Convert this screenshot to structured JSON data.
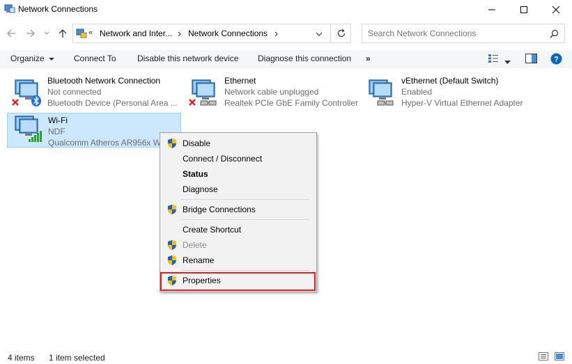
{
  "window": {
    "title": "Network Connections"
  },
  "address": {
    "overflow": "«",
    "crumbs": [
      "Network and Inter...",
      "Network Connections"
    ],
    "search_placeholder": "Search Network Connections"
  },
  "toolbar": {
    "organize": "Organize",
    "connect_to": "Connect To",
    "disable": "Disable this network device",
    "diagnose": "Diagnose this connection",
    "more": "»"
  },
  "connections": [
    {
      "name": "Bluetooth Network Connection",
      "status": "Not connected",
      "device": "Bluetooth Device (Personal Area ...",
      "icon": "bluetooth-network-icon",
      "state": "disconnected"
    },
    {
      "name": "Ethernet",
      "status": "Network cable unplugged",
      "device": "Realtek PCIe GbE Family Controller",
      "icon": "ethernet-network-icon",
      "state": "disconnected"
    },
    {
      "name": "vEthernet (Default Switch)",
      "status": "Enabled",
      "device": "Hyper-V Virtual Ethernet Adapter",
      "icon": "virtual-ethernet-icon",
      "state": "enabled"
    },
    {
      "name": "Wi-Fi",
      "status": "NDF",
      "device": "Qualcomm Atheros AR956x Wi",
      "icon": "wifi-network-icon",
      "state": "connected",
      "selected": true
    }
  ],
  "context_menu": {
    "items": [
      {
        "label": "Disable",
        "shield": true
      },
      {
        "label": "Connect / Disconnect"
      },
      {
        "label": "Status",
        "bold": true
      },
      {
        "label": "Diagnose"
      },
      {
        "label": "Bridge Connections",
        "shield": true
      },
      {
        "label": "Create Shortcut"
      },
      {
        "label": "Delete",
        "shield": true,
        "disabled": true
      },
      {
        "label": "Rename",
        "shield": true
      },
      {
        "label": "Properties",
        "shield": true,
        "highlighted": true
      }
    ]
  },
  "statusbar": {
    "item_count": "4 items",
    "selected": "1 item selected"
  },
  "colors": {
    "accent": "#0067c0",
    "selection_bg": "#cce8ff",
    "highlight_border": "#e31b23"
  }
}
